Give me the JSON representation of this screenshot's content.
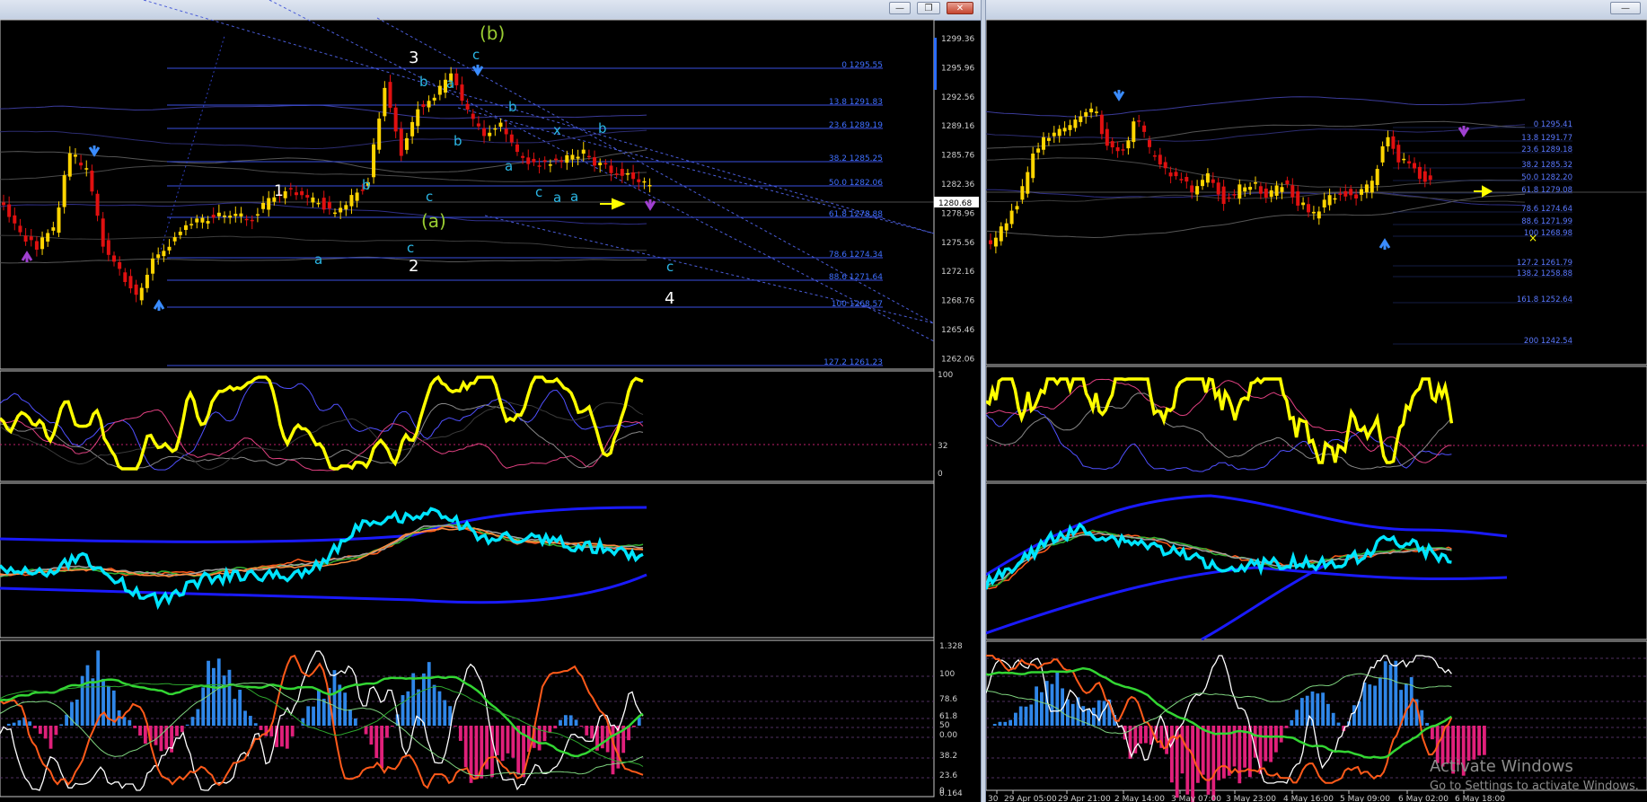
{
  "left_window": {
    "price_axis": [
      "1299.36",
      "1295.96",
      "1292.56",
      "1289.16",
      "1285.76",
      "1282.36",
      "1278.96",
      "1275.56",
      "1272.16",
      "1268.76",
      "1265.46",
      "1262.06"
    ],
    "current_price": "1280.68",
    "fib_levels": [
      "0 1295.55",
      "13.8 1291.83",
      "23.6 1289.19",
      "38.2 1285.25",
      "50.0 1282.06",
      "61.8 1278.88",
      "78.6 1274.34",
      "88.6 1271.64",
      "100 1268.57",
      "127.2 1261.23"
    ],
    "wave_labels": [
      "(b)",
      "3",
      "(a)",
      "1",
      "2",
      "4"
    ],
    "sub_labels": [
      "c",
      "b",
      "a",
      "b",
      "x",
      "b",
      "a",
      "c",
      "a",
      "c",
      "b",
      "a",
      "b",
      "a",
      "c",
      "c"
    ],
    "osc1_axis": [
      "100",
      "32",
      "0"
    ],
    "osc3_axis": [
      "1.328",
      "100",
      "78.6",
      "61.8",
      "50",
      "0.00",
      "38.2",
      "23.6",
      "0",
      "0.164"
    ]
  },
  "right_window": {
    "fib_levels": [
      "0 1295.41",
      "13.8 1291.77",
      "23.6 1289.18",
      "38.2 1285.32",
      "50.0 1282.20",
      "61.8 1279.08",
      "78.6 1274.64",
      "88.6 1271.99",
      "100 1268.98",
      "127.2 1261.79",
      "138.2 1258.88",
      "161.8 1252.64",
      "200 1242.54"
    ],
    "time_axis": [
      "30",
      "29 Apr 05:00",
      "29 Apr 21:00",
      "2 May 14:00",
      "3 May 07:00",
      "3 May 23:00",
      "4 May 16:00",
      "5 May 09:00",
      "6 May 02:00",
      "6 May 18:00"
    ]
  },
  "watermark": {
    "line1": "Activate Windows",
    "line2": "Go to Settings to activate Windows."
  },
  "colors": {
    "candle_up": "#ffd500",
    "candle_down": "#e01010",
    "fib_line": "#3a50e0",
    "fib_text": "#3f6fff",
    "osc_yellow": "#ffff00",
    "cyan": "#00e5ff",
    "blue_band": "#1a1aff",
    "histo_pos": "#2f86e8",
    "histo_neg": "#e0207a",
    "wave_green": "#9acd32",
    "wave_cyan": "#2bb7e6"
  },
  "icons": {
    "minimize": "minimize-icon",
    "restore": "restore-icon",
    "close": "close-icon"
  }
}
